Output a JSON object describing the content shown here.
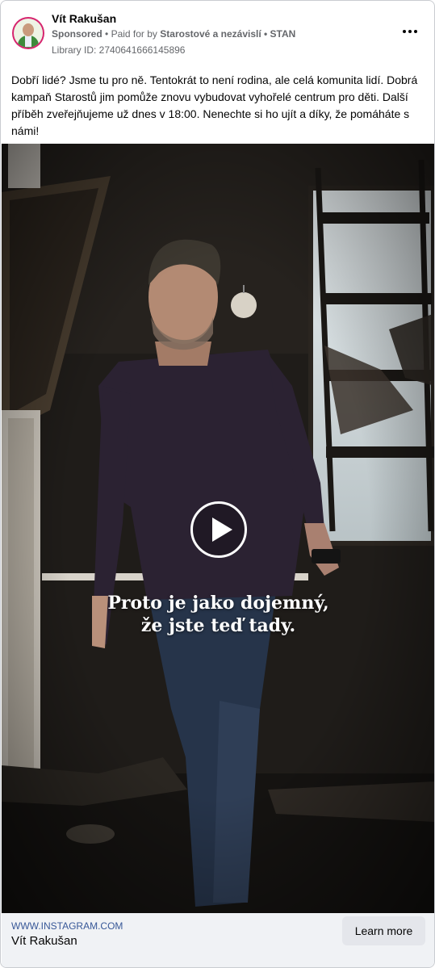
{
  "post": {
    "author": "Vít Rakušan",
    "sponsored": "Sponsored",
    "separator": "•",
    "paid_for_by": "Paid for by",
    "payer": "Starostové a nezávislí • STAN",
    "library_id": "Library ID: 2740641666145896",
    "more_icon": "more-horizontal-icon",
    "text": "Dobří lidé? Jsme tu pro ně. Tentokrát to není rodina, ale celá komunita lidí. Dobrá kampaň Starostů jim pomůže znovu vybudovat vyhořelé centrum pro děti. Další příběh zveřejňujeme už dnes v 18:00. Nenechte si ho ujít a díky, že pomáháte s námi!"
  },
  "video": {
    "play_icon": "play-icon",
    "caption_line1": "Proto je jako dojemný,",
    "caption_line2": "že jste teď tady."
  },
  "footer": {
    "url": "WWW.INSTAGRAM.COM",
    "title": "Vít Rakušan",
    "cta_label": "Learn more"
  },
  "colors": {
    "avatar_ring": "#d6246e",
    "link_blue": "#385898",
    "footer_bg": "#f0f2f5",
    "button_bg": "#e4e6eb",
    "meta_gray": "#65676b"
  }
}
